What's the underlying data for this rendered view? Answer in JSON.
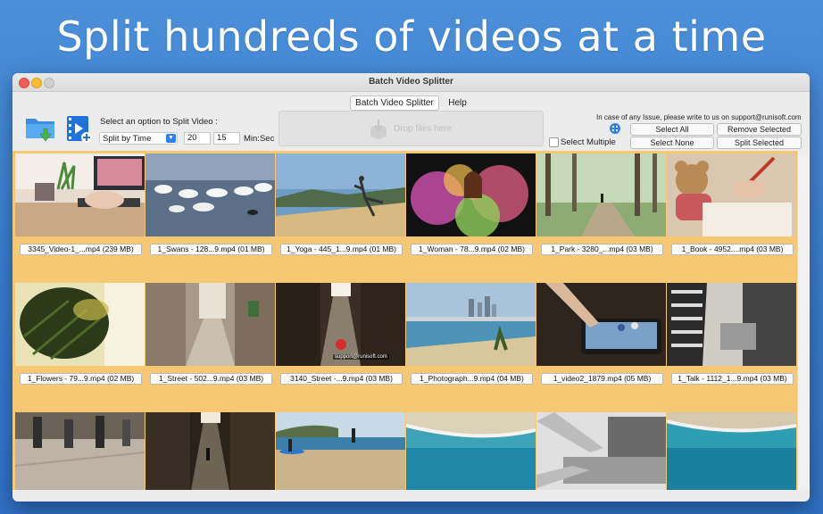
{
  "headline": "Split hundreds of videos at a time",
  "window": {
    "title": "Batch Video Splitter",
    "tabs": [
      "Batch Video Splitter",
      "Help"
    ]
  },
  "toolbar": {
    "option_label": "Select an option to Split Video :",
    "split_mode": "Split by Time",
    "minutes": "20",
    "seconds": "15",
    "unit_label": "Min:Sec",
    "drop_placeholder": "Drop files here",
    "support_text": "In case of any Issue, please write to us on support@runisoft.com",
    "select_all": "Select All",
    "remove_selected": "Remove Selected",
    "select_none": "Select None",
    "split_selected": "Split Selected",
    "select_multiple": "Select Multiple"
  },
  "videos": [
    {
      "caption": "3345_Video-1_...mp4 (239 MB)",
      "thumb": "laptop-desk"
    },
    {
      "caption": "1_Swans - 128...9.mp4 (01 MB)",
      "thumb": "swans"
    },
    {
      "caption": "1_Yoga - 445_1...9.mp4 (01 MB)",
      "thumb": "yoga"
    },
    {
      "caption": "1_Woman - 78...9.mp4 (02 MB)",
      "thumb": "woman-colors"
    },
    {
      "caption": "1_Park - 3280_...mp4 (03 MB)",
      "thumb": "park"
    },
    {
      "caption": "1_Book - 4952....mp4 (03 MB)",
      "thumb": "book-bear"
    },
    {
      "caption": "1_Flowers - 79...9.mp4 (02 MB)",
      "thumb": "flowers"
    },
    {
      "caption": "1_Street - 502...9.mp4 (03 MB)",
      "thumb": "street"
    },
    {
      "caption": "3140_Street -...9.mp4 (03 MB)",
      "thumb": "alley",
      "watermark": "support@runisoft.com"
    },
    {
      "caption": "1_Photograph...9.mp4 (04 MB)",
      "thumb": "city-beach"
    },
    {
      "caption": "1_video2_1879.mp4 (05 MB)",
      "thumb": "phone-hand"
    },
    {
      "caption": "1_Talk - 1112_1...9.mp4 (03 MB)",
      "thumb": "talk"
    },
    {
      "caption": "",
      "thumb": "pedestrians"
    },
    {
      "caption": "",
      "thumb": "dark-alley"
    },
    {
      "caption": "",
      "thumb": "surfer-beach"
    },
    {
      "caption": "",
      "thumb": "aerial-sea"
    },
    {
      "caption": "",
      "thumb": "laptop-typing"
    },
    {
      "caption": "",
      "thumb": "aerial-sea-2"
    }
  ],
  "colors": {
    "gallery_bg": "#f7c873",
    "accent": "#2f7ff0",
    "page_bg": "#3b7fd0"
  }
}
